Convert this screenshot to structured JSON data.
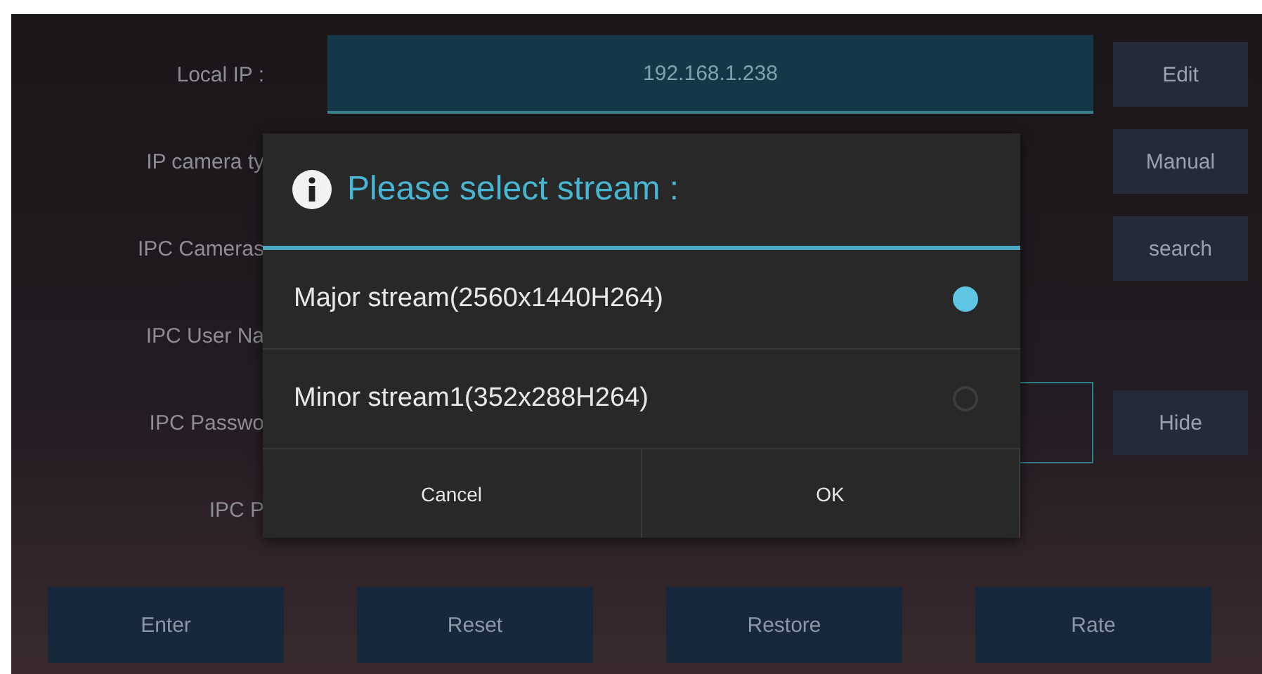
{
  "form": {
    "rows": [
      {
        "kind": "field",
        "label": "Local IP :",
        "value": "192.168.1.238",
        "button": "Edit"
      },
      {
        "kind": "plain",
        "label": "IP camera ty",
        "button": "Manual"
      },
      {
        "kind": "plain",
        "label": "IPC Cameras",
        "button": "search"
      },
      {
        "kind": "plain",
        "label": "IPC User Na"
      },
      {
        "kind": "outline",
        "label": "IPC Passwo",
        "button": "Hide"
      },
      {
        "kind": "plain",
        "label": "IPC P"
      }
    ]
  },
  "actions": [
    "Enter",
    "Reset",
    "Restore",
    "Rate"
  ],
  "dialog": {
    "title": "Please select stream :",
    "options": [
      {
        "label": "Major stream(2560x1440H264)",
        "selected": true
      },
      {
        "label": "Minor stream1(352x288H264)",
        "selected": false
      }
    ],
    "buttons": [
      "Cancel",
      "OK"
    ]
  }
}
